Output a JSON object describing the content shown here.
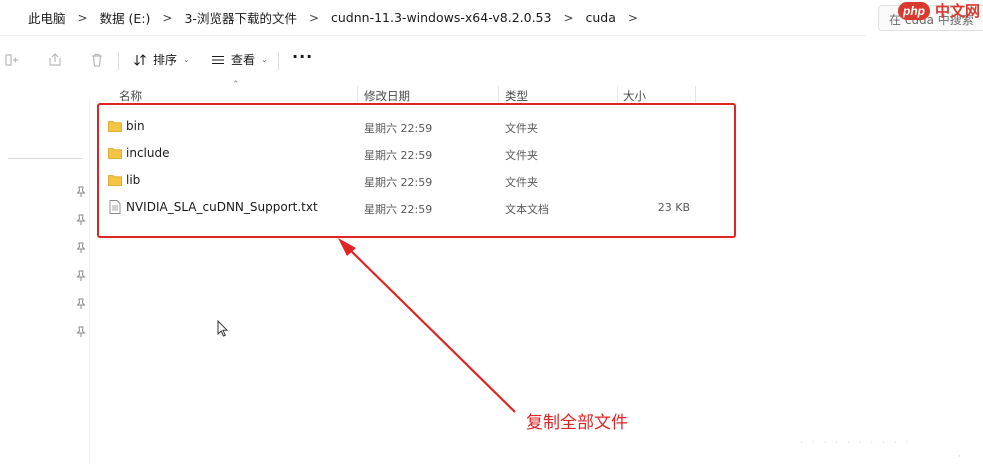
{
  "breadcrumb": [
    "此电脑",
    "数据 (E:)",
    "3-浏览器下载的文件",
    "cudnn-11.3-windows-x64-v8.2.0.53",
    "cuda"
  ],
  "breadcrumb_separator": ">",
  "search": {
    "text": "在 cuda 中搜索"
  },
  "watermark": {
    "badge": "php",
    "text": "中文网"
  },
  "toolbar": {
    "sort_label": "排序",
    "view_label": "查看",
    "more_label": "···"
  },
  "columns": {
    "name": "名称",
    "modified": "修改日期",
    "type": "类型",
    "size": "大小"
  },
  "files": [
    {
      "name": "bin",
      "modified": "星期六 22:59",
      "type": "文件夹",
      "size": "",
      "icon": "folder-icon"
    },
    {
      "name": "include",
      "modified": "星期六 22:59",
      "type": "文件夹",
      "size": "",
      "icon": "folder-icon"
    },
    {
      "name": "lib",
      "modified": "星期六 22:59",
      "type": "文件夹",
      "size": "",
      "icon": "folder-icon"
    },
    {
      "name": "NVIDIA_SLA_cuDNN_Support.txt",
      "modified": "星期六 22:59",
      "type": "文本文档",
      "size": "23 KB",
      "icon": "text-file-icon"
    }
  ],
  "annotation": {
    "text": "复制全部文件",
    "color": "#e02424"
  },
  "colors": {
    "folder": "#f4c542",
    "annotation_red": "#e02424"
  }
}
